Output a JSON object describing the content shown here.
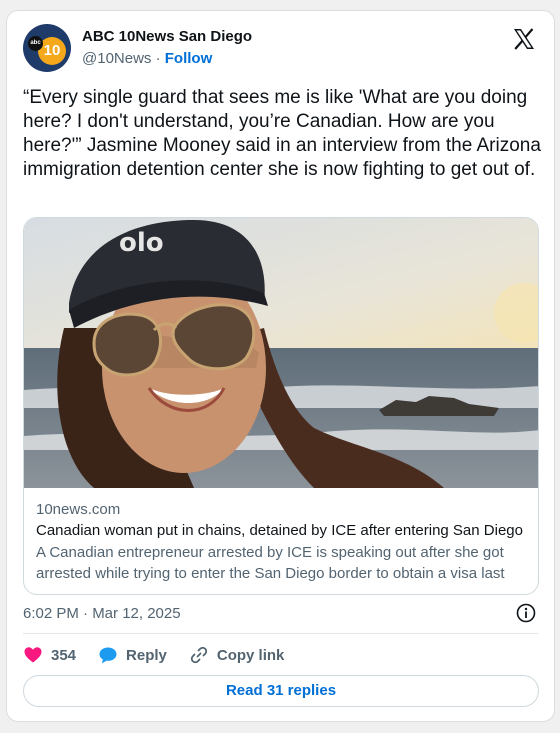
{
  "account": {
    "display_name": "ABC 10News San Diego",
    "handle": "@10News",
    "separator": "·",
    "follow_label": "Follow",
    "avatar_logo": "abc",
    "avatar_number": "10"
  },
  "tweet": {
    "text": "“Every single guard that sees me is like 'What are you doing here? I don't understand, you’re Canadian. How are you here?'” Jasmine Mooney said in an interview from the Arizona immigration detention center she is now fighting to get out of."
  },
  "link_card": {
    "cap_logo": "olo",
    "domain": "10news.com",
    "title": "Canadian woman put in chains, detained by ICE after entering San Diego",
    "description": "A Canadian entrepreneur arrested by ICE is speaking out after she got arrested while trying to enter the San Diego border to obtain a visa last week."
  },
  "meta": {
    "timestamp": "6:02 PM · Mar 12, 2025"
  },
  "actions": {
    "likes_count": "354",
    "reply_label": "Reply",
    "copy_link_label": "Copy link",
    "read_replies_label": "Read 31 replies"
  },
  "icons": {
    "brand": "x-logo-icon",
    "info": "info-icon",
    "like": "heart-icon",
    "reply": "speech-bubble-icon",
    "copy": "link-icon"
  },
  "colors": {
    "like": "#f91880",
    "reply": "#1d9bf0",
    "link": "#006fd6",
    "secondary_text": "#536471"
  }
}
